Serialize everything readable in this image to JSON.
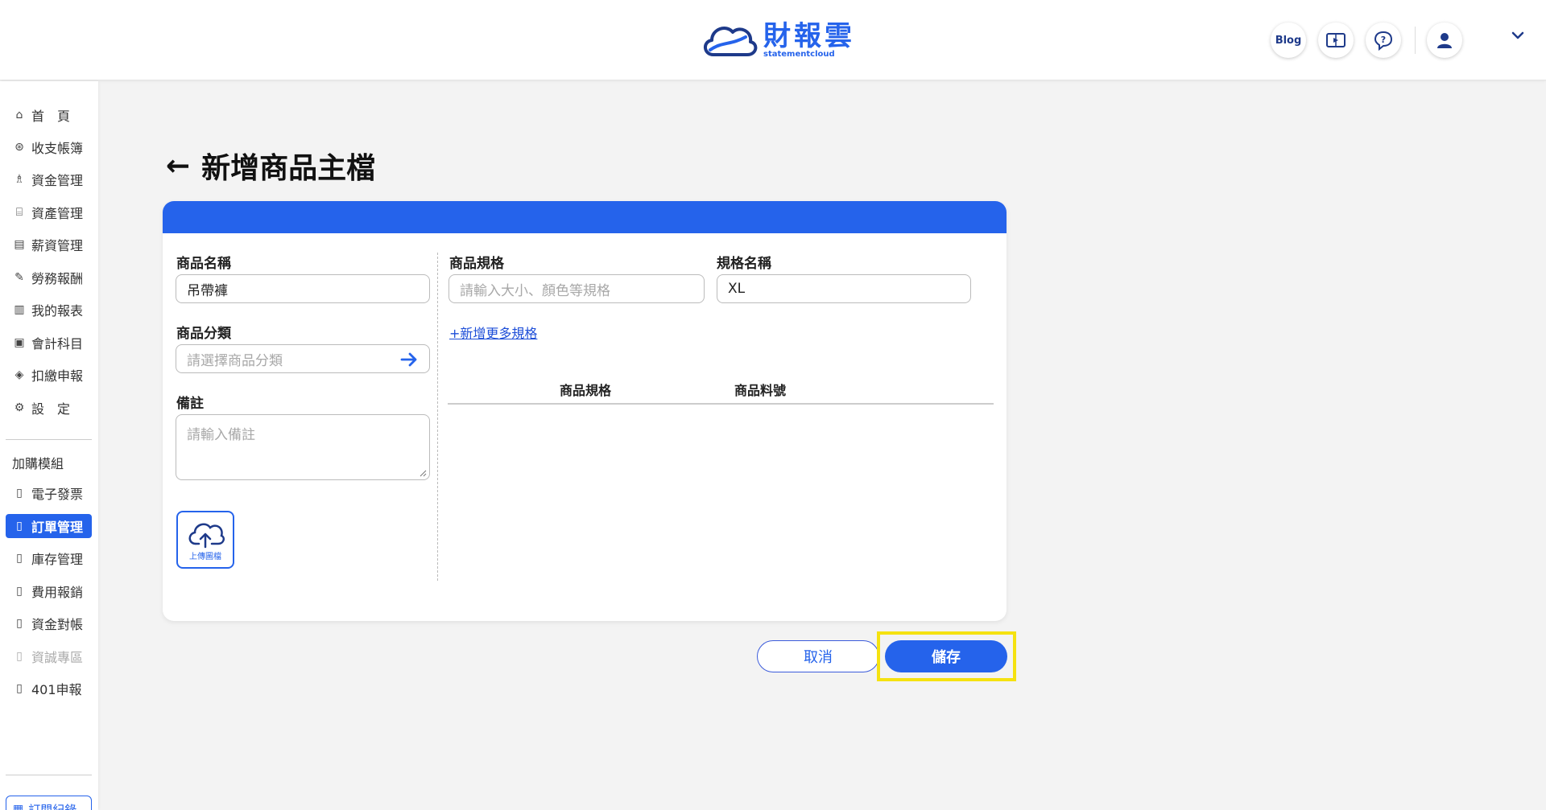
{
  "header": {
    "logo_name": "財報雲",
    "logo_sub": "statementcloud",
    "blog_label": "Blog"
  },
  "sidebar": {
    "items": [
      {
        "label": "首　頁",
        "icon": "home-icon"
      },
      {
        "label": "收支帳簿",
        "icon": "coin-icon"
      },
      {
        "label": "資金管理",
        "icon": "money-bag-icon"
      },
      {
        "label": "資產管理",
        "icon": "bank-icon"
      },
      {
        "label": "薪資管理",
        "icon": "payroll-icon"
      },
      {
        "label": "勞務報酬",
        "icon": "worker-icon"
      },
      {
        "label": "我的報表",
        "icon": "chart-icon"
      },
      {
        "label": "會計科目",
        "icon": "ledger-icon"
      },
      {
        "label": "扣繳申報",
        "icon": "tax-icon"
      },
      {
        "label": "設　定",
        "icon": "settings-icon"
      }
    ],
    "addon_title": "加購模組",
    "addons": [
      {
        "label": "電子發票",
        "state": "normal"
      },
      {
        "label": "訂單管理",
        "state": "active"
      },
      {
        "label": "庫存管理",
        "state": "normal"
      },
      {
        "label": "費用報銷",
        "state": "normal"
      },
      {
        "label": "資金對帳",
        "state": "normal"
      },
      {
        "label": "資誠專區",
        "state": "disabled"
      },
      {
        "label": "401申報",
        "state": "normal"
      }
    ],
    "bottom_label": "訂閱紀錄"
  },
  "page": {
    "back_arrow": "←",
    "title": "新增商品主檔"
  },
  "form": {
    "product_name_label": "商品名稱",
    "product_name_value": "吊帶褲",
    "category_label": "商品分類",
    "category_placeholder": "請選擇商品分類",
    "notes_label": "備註",
    "notes_placeholder": "請輸入備註",
    "upload_label": "上傳圖檔",
    "spec_label": "商品規格",
    "spec_placeholder": "請輸入大小、顏色等規格",
    "spec_name_label": "規格名稱",
    "spec_name_value": "XL",
    "add_spec_link": "+新增更多規格",
    "table_headers": [
      "商品規格",
      "商品料號"
    ]
  },
  "actions": {
    "cancel_label": "取消",
    "save_label": "儲存"
  },
  "colors": {
    "primary": "#2563eb",
    "highlight": "#f5e210"
  }
}
